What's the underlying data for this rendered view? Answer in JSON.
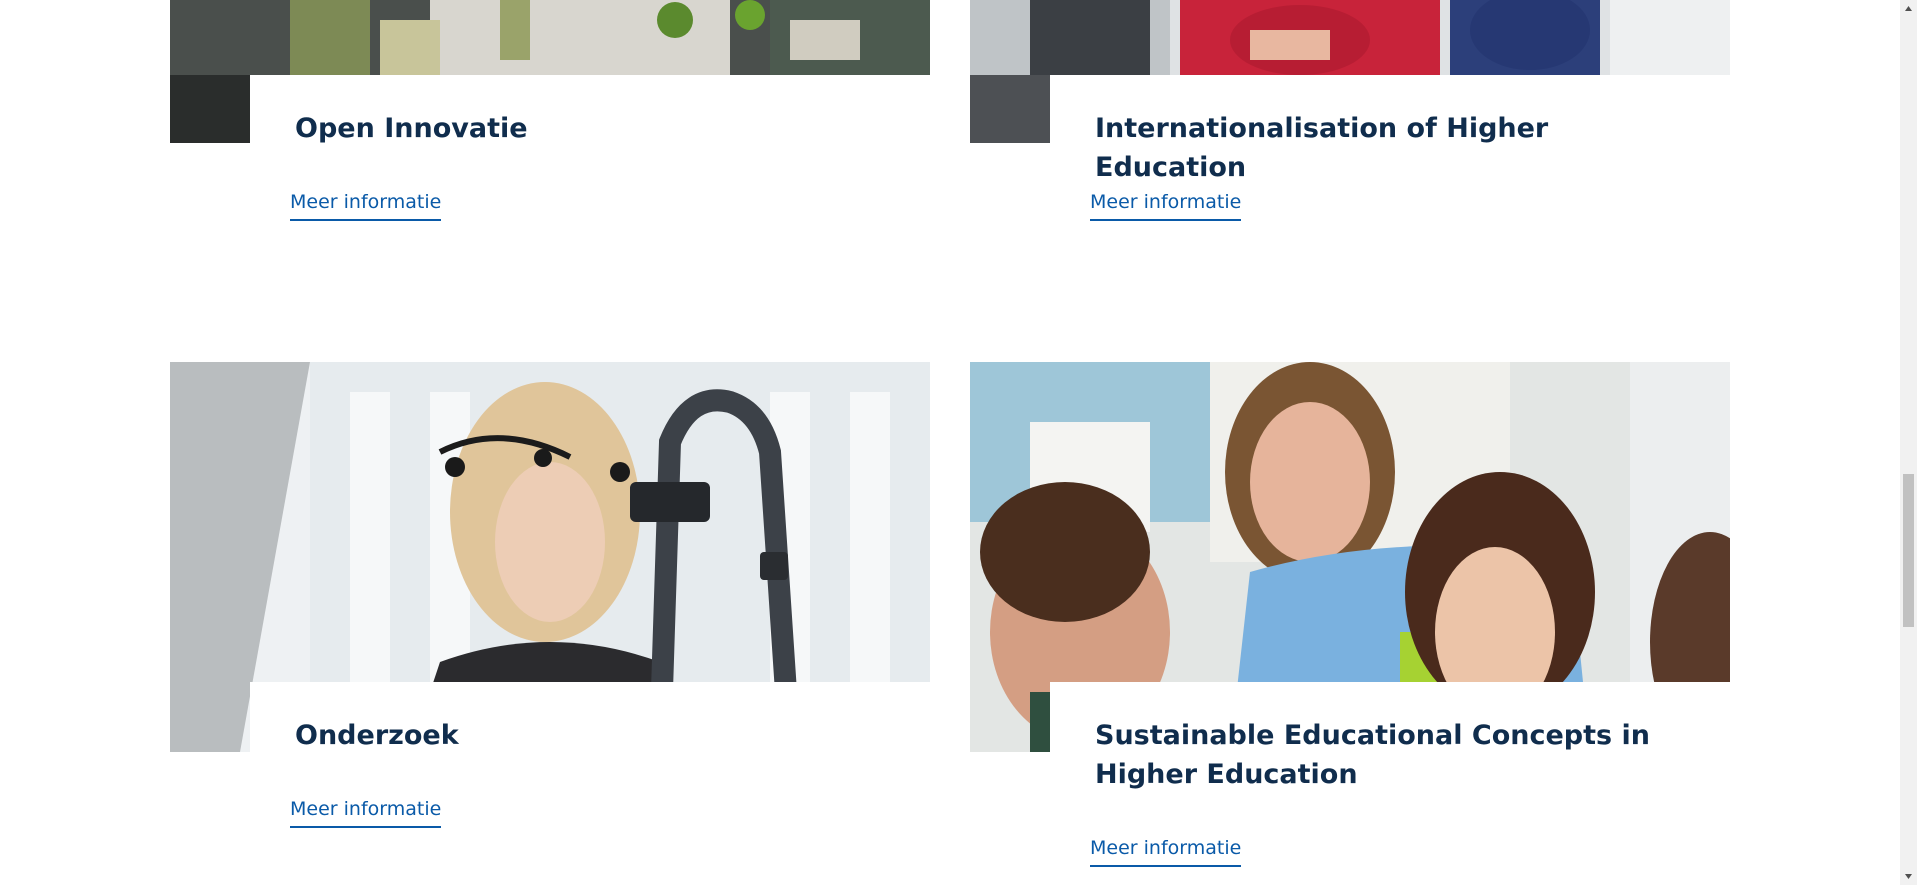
{
  "cards": [
    {
      "title": "Open Innovatie",
      "link": "Meer informatie"
    },
    {
      "title": "Internationalisation of Higher Education",
      "link": "Meer informatie"
    },
    {
      "title": "Onderzoek",
      "link": "Meer informatie"
    },
    {
      "title": "Sustainable Educational Concepts in Higher Education",
      "link": "Meer informatie"
    }
  ],
  "colors": {
    "heading": "#102d4d",
    "link": "#0a5aa8"
  },
  "images": [
    "office-coworking-photo",
    "students-laptop-photo",
    "eye-tracking-research-photo",
    "teacher-students-classroom-photo"
  ]
}
